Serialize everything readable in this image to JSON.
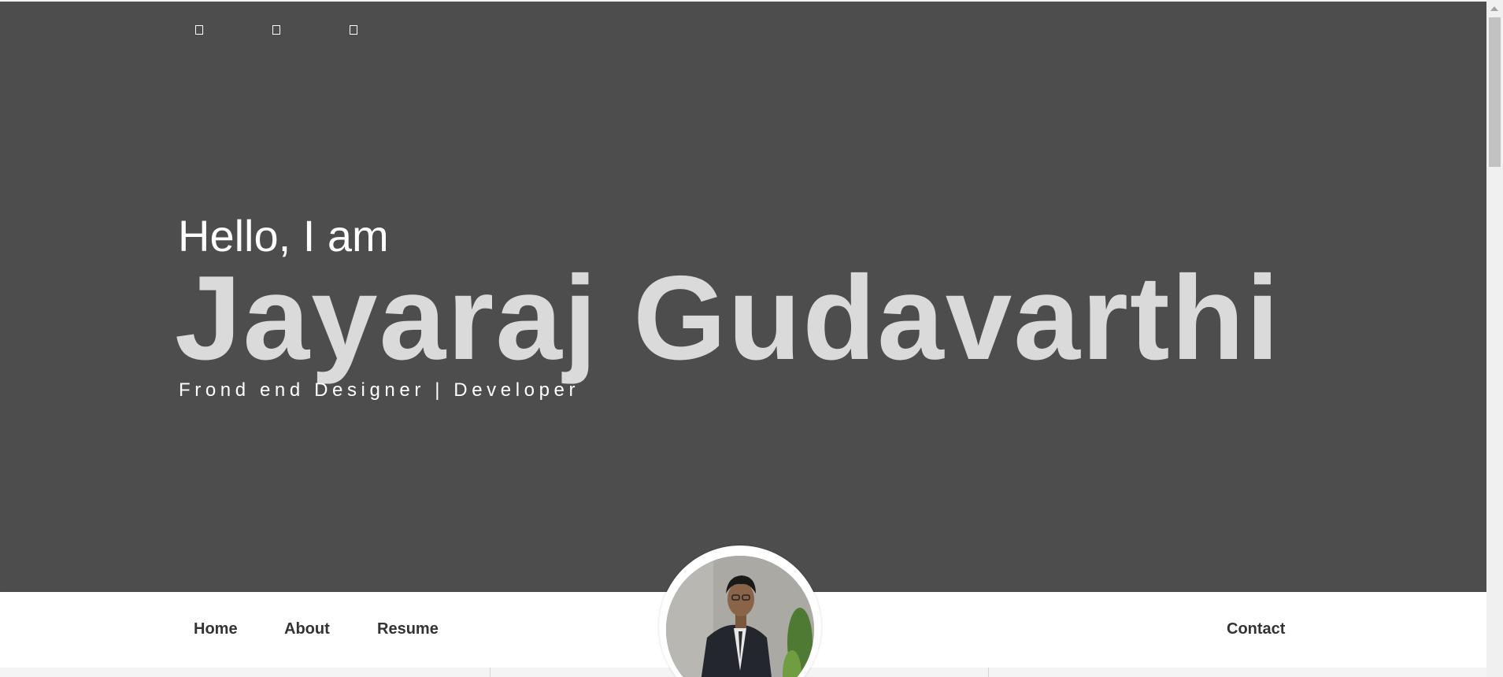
{
  "social": {
    "icons": [
      "social-icon-1",
      "social-icon-2",
      "social-icon-3"
    ]
  },
  "hero": {
    "greeting": "Hello, I am",
    "name": "Jayaraj Gudavarthi",
    "tagline": "Frond end Designer | Developer"
  },
  "nav": {
    "home": "Home",
    "about": "About",
    "resume": "Resume",
    "contact": "Contact"
  },
  "colors": {
    "hero_background": "#4d4d4d",
    "name_text": "#dadada",
    "navbar_background": "#ffffff",
    "nav_text": "#333333"
  }
}
